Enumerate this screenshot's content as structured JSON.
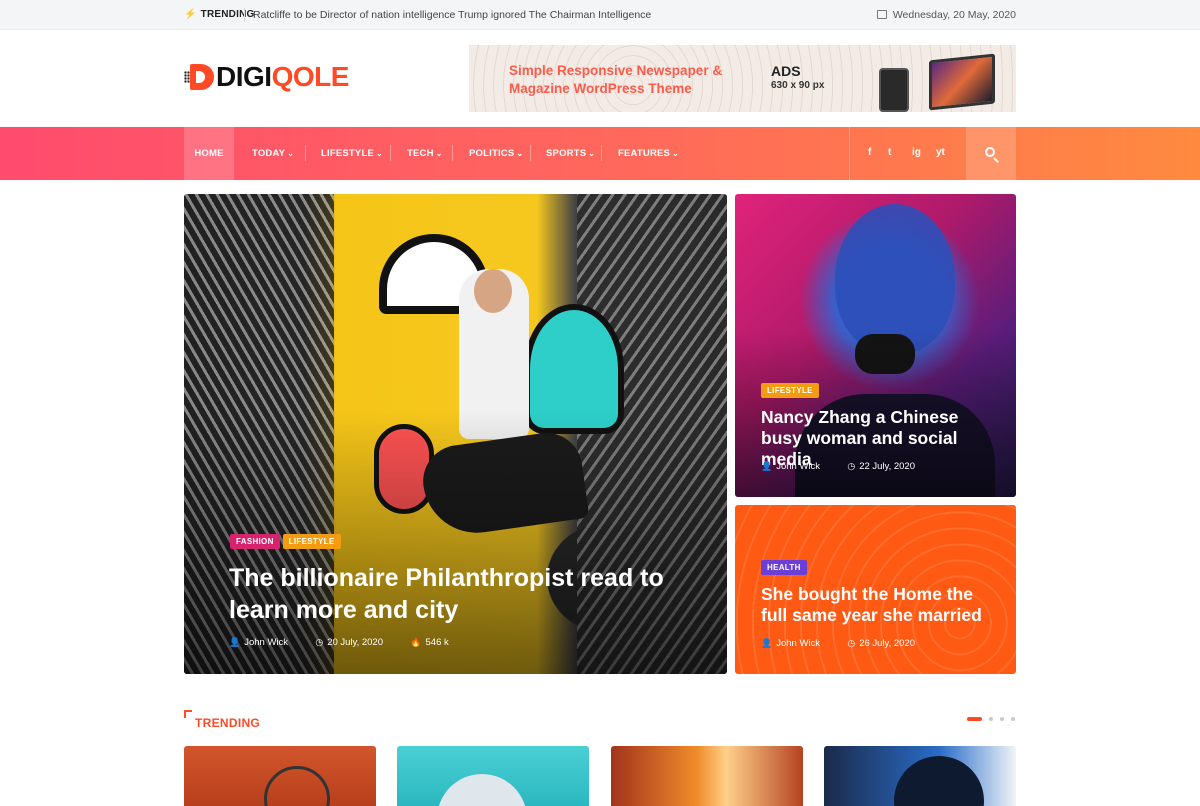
{
  "topbar": {
    "trending_label": "TRENDING",
    "ticker": "Ratcliffe to be Director of nation intelligence Trump ignored The Chairman Intelligence",
    "date": "Wednesday, 20 May, 2020"
  },
  "brand": {
    "part1": "DIGI",
    "part2": "QOLE"
  },
  "ad": {
    "tagline_line1": "Simple Responsive Newspaper &",
    "tagline_line2": "Magazine WordPress Theme",
    "title": "ADS",
    "size": "630 x 90 px"
  },
  "nav": {
    "items": [
      "HOME",
      "TODAY",
      "LIFESTYLE",
      "TECH",
      "POLITICS",
      "SPORTS",
      "FEATURES"
    ],
    "socials": [
      "f",
      "t",
      "ig",
      "yt"
    ]
  },
  "hero": {
    "main": {
      "badges": [
        "FASHION",
        "LIFESTYLE"
      ],
      "title": "The billionaire Philanthropist read to learn more and city",
      "author": "John Wick",
      "date": "20 July, 2020",
      "views": "546 k"
    },
    "side1": {
      "badge": "LIFESTYLE",
      "title": "Nancy Zhang a Chinese busy woman and social media",
      "author": "John Wick",
      "date": "22 July, 2020"
    },
    "side2": {
      "badge": "HEALTH",
      "title": "She bought the Home the full same year she married",
      "author": "John Wick",
      "date": "26 July, 2020"
    }
  },
  "trending": {
    "title": "TRENDING"
  },
  "colors": {
    "accent": "#ff4a25",
    "nav_start": "#ff4b6e",
    "nav_end": "#ff8a3f",
    "fashion": "#d6236b",
    "lifestyle": "#f39c12",
    "health": "#6a3fd8"
  }
}
